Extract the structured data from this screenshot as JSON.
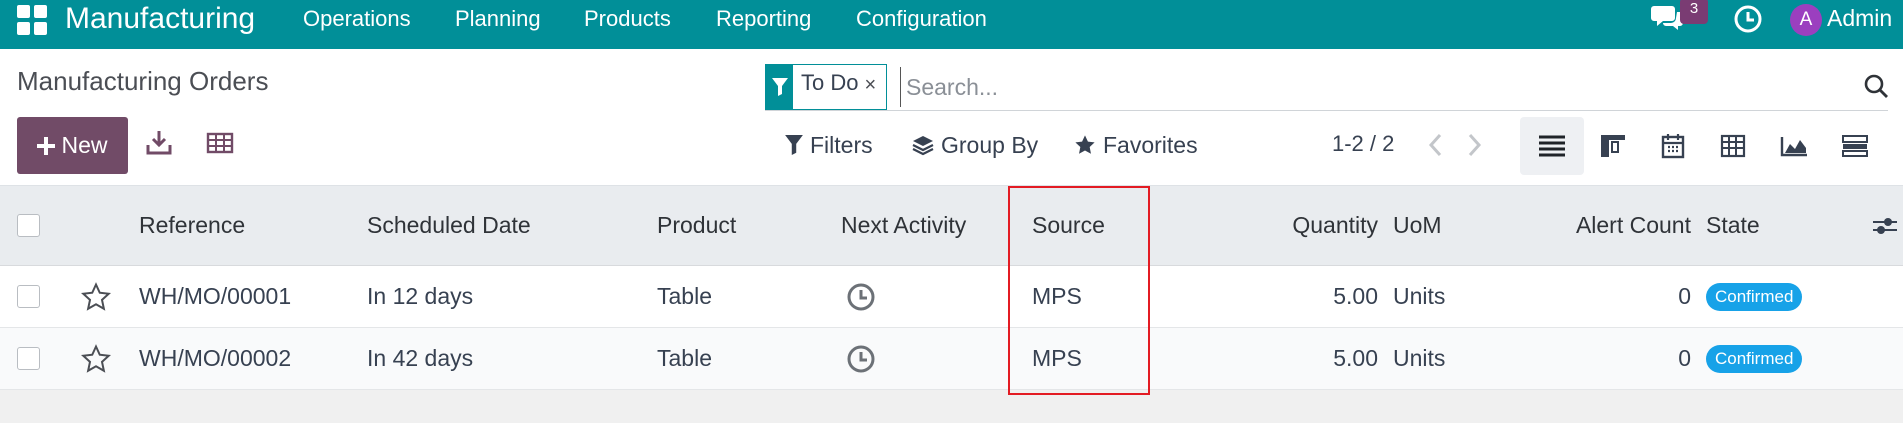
{
  "navbar": {
    "brand": "Manufacturing",
    "menu": [
      "Operations",
      "Planning",
      "Products",
      "Reporting",
      "Configuration"
    ],
    "chat_count": "3",
    "avatar_initial": "A",
    "user": "Admin"
  },
  "control_panel": {
    "title": "Manufacturing Orders",
    "facet_label": "To Do",
    "facet_close": "×",
    "search_placeholder": "Search...",
    "new_label": "New",
    "filters_label": "Filters",
    "groupby_label": "Group By",
    "favorites_label": "Favorites",
    "pager": "1-2 / 2"
  },
  "table": {
    "headers": {
      "reference": "Reference",
      "scheduled_date": "Scheduled Date",
      "product": "Product",
      "next_activity": "Next Activity",
      "source": "Source",
      "quantity": "Quantity",
      "uom": "UoM",
      "alert_count": "Alert Count",
      "state": "State"
    },
    "rows": [
      {
        "reference": "WH/MO/00001",
        "scheduled_date": "In 12 days",
        "product": "Table",
        "source": "MPS",
        "quantity": "5.00",
        "uom": "Units",
        "alert_count": "0",
        "state": "Confirmed"
      },
      {
        "reference": "WH/MO/00002",
        "scheduled_date": "In 42 days",
        "product": "Table",
        "source": "MPS",
        "quantity": "5.00",
        "uom": "Units",
        "alert_count": "0",
        "state": "Confirmed"
      }
    ]
  },
  "colors": {
    "navbar": "#018f98",
    "primary_button": "#714b67",
    "badge": "#17a2e8",
    "highlight": "#e31b23"
  }
}
